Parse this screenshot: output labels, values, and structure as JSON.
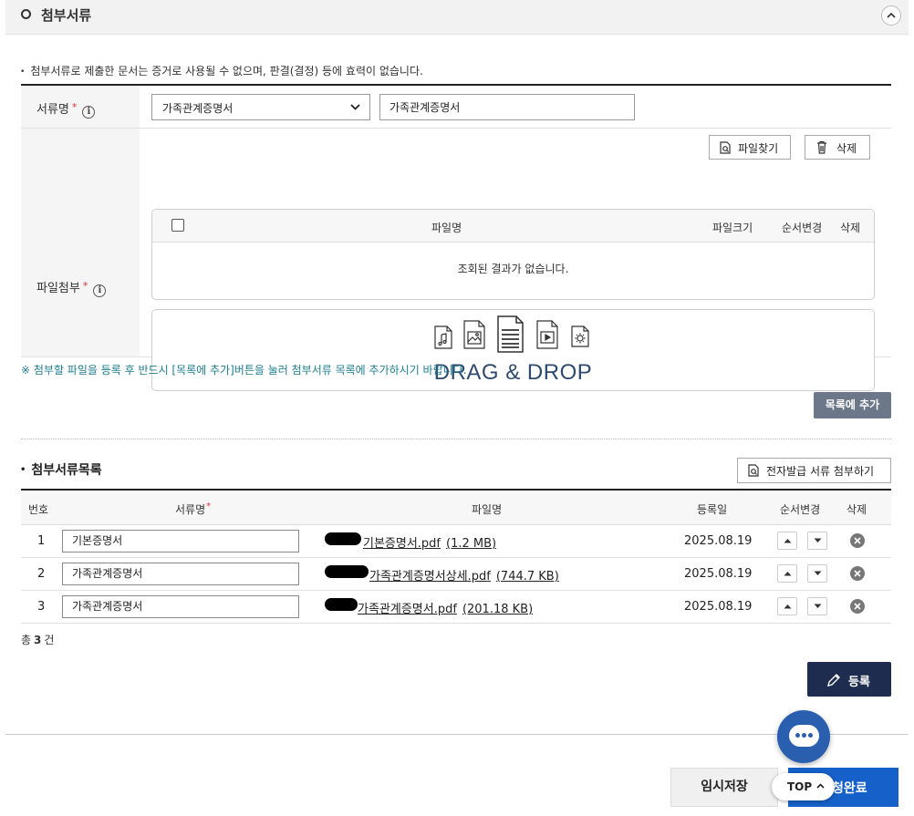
{
  "section": {
    "title": "첨부서류"
  },
  "notice": "첨부서류로 제출한 문서는 증거로 사용될 수 없으며, 판결(결정) 등에 효력이 없습니다.",
  "form": {
    "doc_name_label": "서류명",
    "file_attach_label": "파일첨부",
    "required_mark": "*",
    "info_glyph": "i",
    "select_value": "가족관계증명서",
    "input_value": "가족관계증명서",
    "find_file_label": "파일찾기",
    "delete_label": "삭제",
    "grid_headers": {
      "filename": "파일명",
      "filesize": "파일크기",
      "order": "순서변경",
      "delete": "삭제"
    },
    "empty_message": "조회된 결과가 없습니다.",
    "drop_text": "DRAG & DROP"
  },
  "hint": "※ 첨부할 파일을 등록 후 반드시 [목록에 추가]버튼을 눌러 첨부서류 목록에 추가하시기 바랍니다.",
  "add_to_list_label": "목록에 추가",
  "list": {
    "title": "첨부서류목록",
    "efile_button_label": "전자발급 서류 첨부하기",
    "headers": {
      "num": "번호",
      "doc_name": "서류명",
      "filename": "파일명",
      "reg_date": "등록일",
      "order": "순서변경",
      "delete": "삭제"
    },
    "rows": [
      {
        "num": "1",
        "doc_name": "기본증명서",
        "filename": "기본증명서.pdf",
        "size": "(1.2 MB)",
        "date": "2025.08.19"
      },
      {
        "num": "2",
        "doc_name": "가족관계증명서",
        "filename": "가족관계증명서상세.pdf",
        "size": "(744.7 KB)",
        "date": "2025.08.19"
      },
      {
        "num": "3",
        "doc_name": "가족관계증명서",
        "filename": "가족관계증명서.pdf",
        "size": "(201.18 KB)",
        "date": "2025.08.19"
      }
    ],
    "total_prefix": "총",
    "total_count": "3",
    "total_suffix": "건"
  },
  "register_label": "등록",
  "temp_save_label": "임시저장",
  "complete_label": "청완료",
  "top_label": "TOP",
  "colors": {
    "navy": "#1e2d4f",
    "primary": "#1560c9",
    "hint": "#1e7d8c",
    "drop_text": "#2f4a6e"
  }
}
